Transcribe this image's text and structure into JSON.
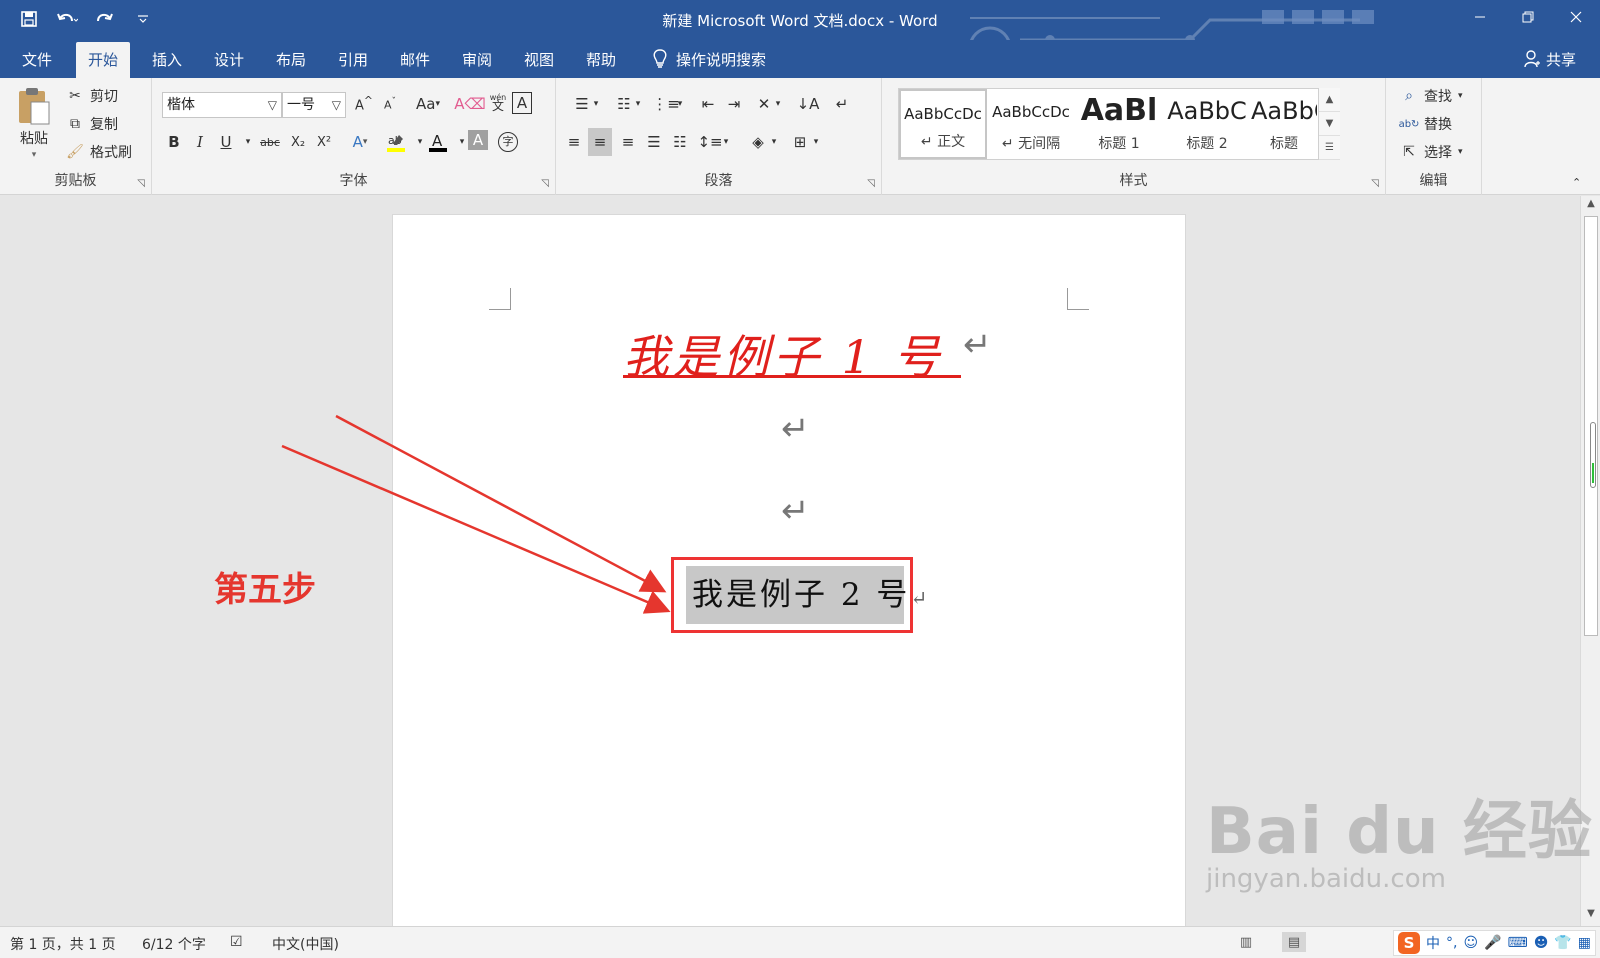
{
  "window": {
    "title": "新建 Microsoft Word 文档.docx  -  Word"
  },
  "menu": {
    "tabs": [
      "文件",
      "开始",
      "插入",
      "设计",
      "布局",
      "引用",
      "邮件",
      "审阅",
      "视图",
      "帮助"
    ],
    "active_tab": "开始",
    "tell_me": "操作说明搜索",
    "share": "共享"
  },
  "ribbon": {
    "clipboard": {
      "label": "剪贴板",
      "paste": "粘贴",
      "cut": "剪切",
      "copy": "复制",
      "format_painter": "格式刷"
    },
    "font": {
      "label": "字体",
      "font_name": "楷体",
      "font_size": "一号",
      "change_case": "Aa",
      "bold": "B",
      "italic": "I",
      "underline": "U",
      "strikethrough": "abc",
      "subscript": "X₂",
      "superscript": "X²",
      "phonetic_top": "wén",
      "phonetic_bottom": "文",
      "enclosed_char": "字"
    },
    "paragraph": {
      "label": "段落"
    },
    "styles": {
      "label": "样式",
      "items": [
        {
          "sample": "AaBbCcDc",
          "name": "↵ 正文"
        },
        {
          "sample": "AaBbCcDc",
          "name": "↵ 无间隔"
        },
        {
          "sample": "AaBl",
          "name": "标题 1"
        },
        {
          "sample": "AaBbC",
          "name": "标题 2"
        },
        {
          "sample": "AaBbC",
          "name": "标题"
        }
      ]
    },
    "editing": {
      "label": "编辑",
      "find": "查找",
      "replace": "替换",
      "select": "选择"
    }
  },
  "document": {
    "line1": "我是例子 1 号",
    "line2": "我是例子 2 号",
    "paragraph_mark": "↵"
  },
  "annotation": {
    "text": "第五步",
    "color": "#e5362e"
  },
  "status": {
    "page": "第 1 页，共 1 页",
    "words": "6/12 个字",
    "language": "中文(中国)"
  },
  "ime": {
    "mode": "中",
    "punct": "°,"
  },
  "watermark": {
    "title": "Bai du 经验",
    "url": "jingyan.baidu.com"
  },
  "colors": {
    "accent": "#2b579a",
    "doc_red": "#e0201c"
  }
}
